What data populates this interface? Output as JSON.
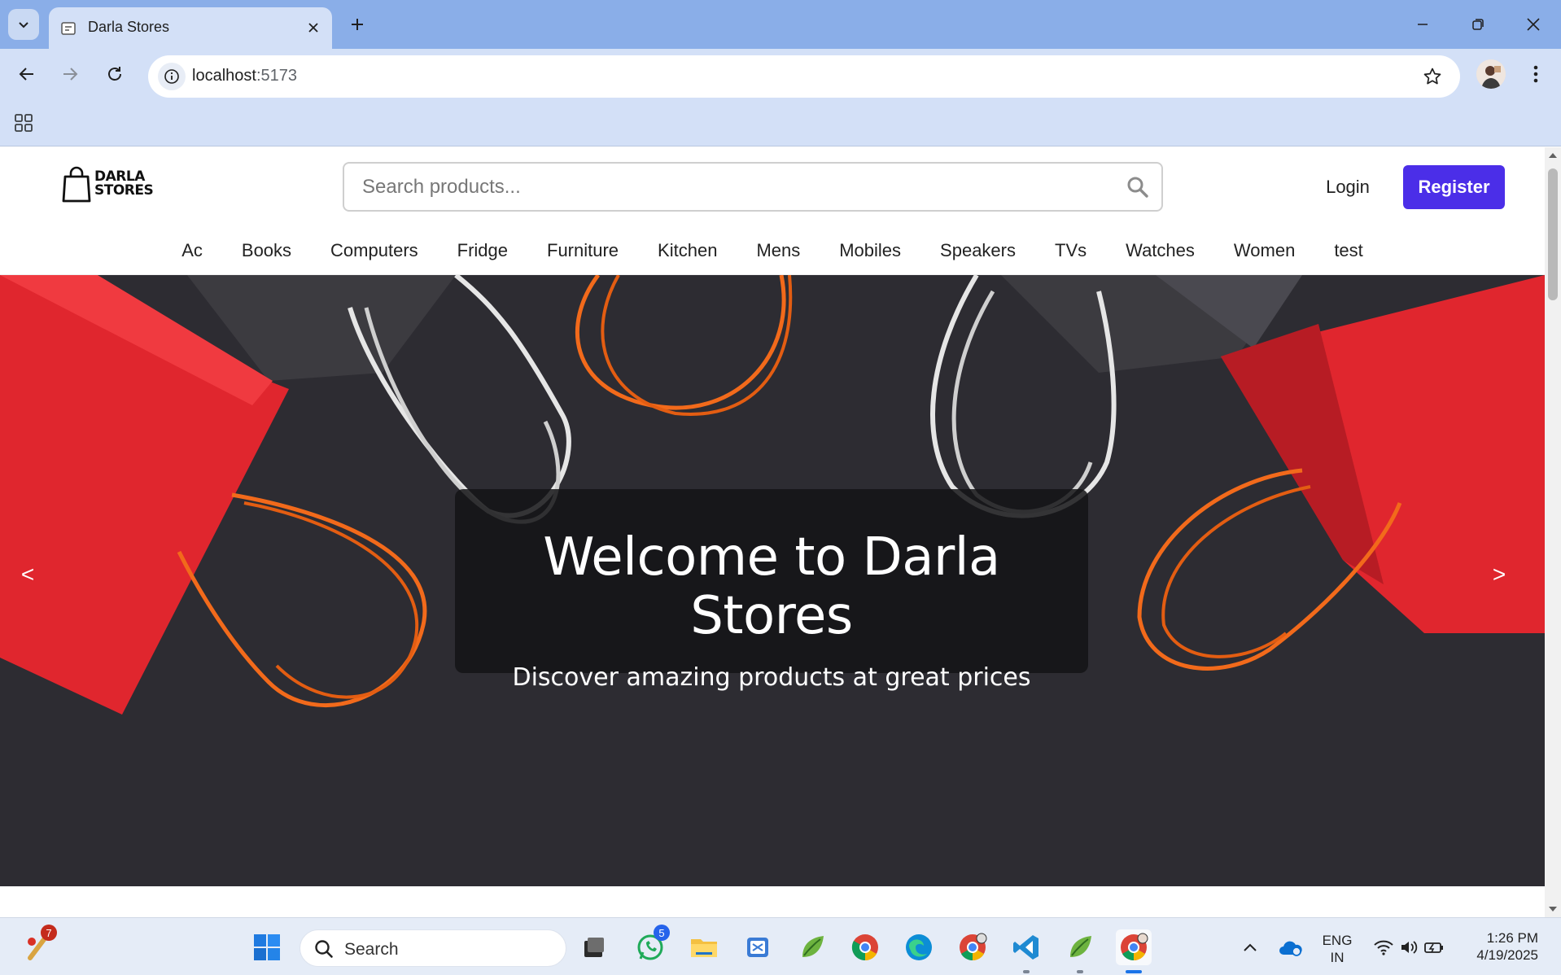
{
  "browser": {
    "tab_title": "Darla Stores",
    "url_host": "localhost",
    "url_port": ":5173"
  },
  "site": {
    "logo_line1": "DARLA",
    "logo_line2": "STORES",
    "search_placeholder": "Search products...",
    "login_label": "Login",
    "register_label": "Register",
    "categories": [
      "Ac",
      "Books",
      "Computers",
      "Fridge",
      "Furniture",
      "Kitchen",
      "Mens",
      "Mobiles",
      "Speakers",
      "TVs",
      "Watches",
      "Women",
      "test"
    ],
    "hero": {
      "title": "Welcome to Darla Stores",
      "subtitle": "Discover amazing products at great prices",
      "prev": "<",
      "next": ">"
    },
    "accent_color": "#4b2ee8"
  },
  "taskbar": {
    "search_label": "Search",
    "lang_line1": "ENG",
    "lang_line2": "IN",
    "time": "1:26 PM",
    "date": "4/19/2025",
    "badge_first": "7",
    "badge_whatsapp": "5"
  }
}
